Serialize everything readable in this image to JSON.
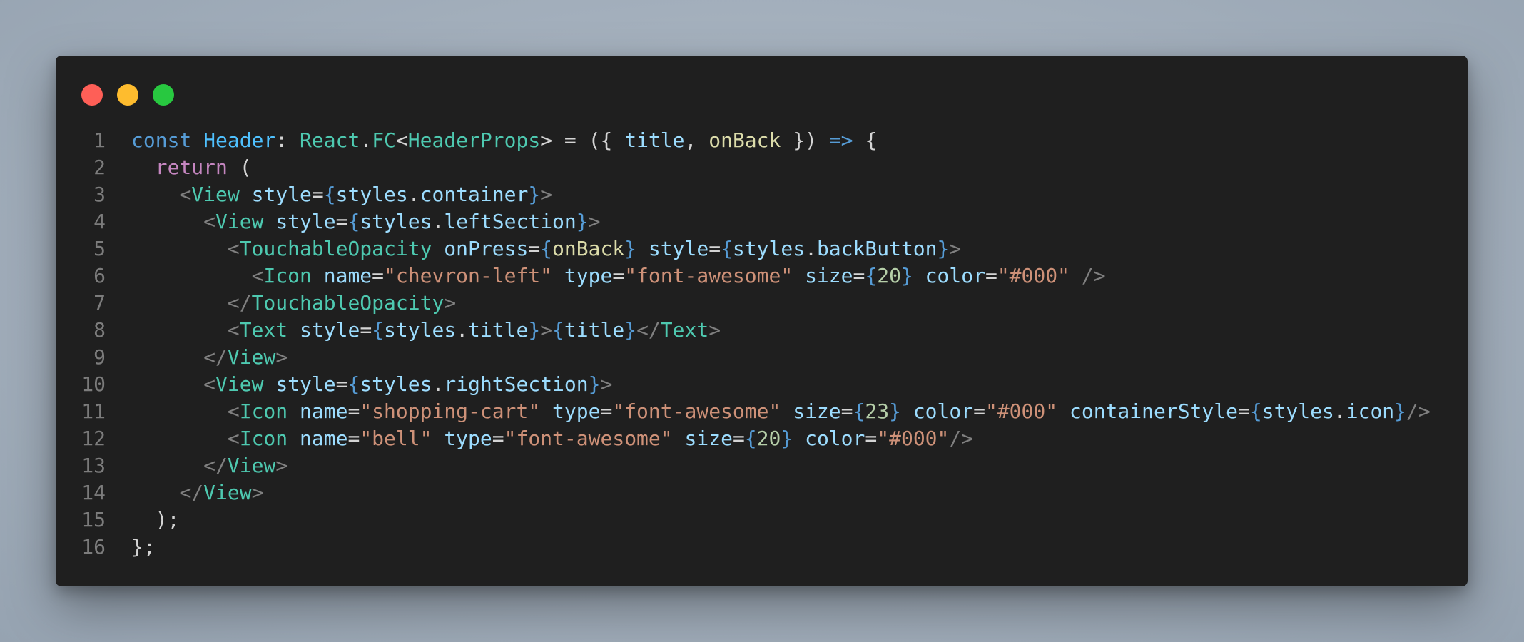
{
  "window": {
    "buttons": [
      {
        "name": "close",
        "color": "#fe5f57"
      },
      {
        "name": "minimize",
        "color": "#febc2e"
      },
      {
        "name": "maximize",
        "color": "#28c840"
      }
    ]
  },
  "code": {
    "lines": [
      {
        "n": "1",
        "tokens": [
          [
            "const",
            "kw"
          ],
          [
            " ",
            "pu"
          ],
          [
            "Header",
            "cn"
          ],
          [
            ": ",
            "pu"
          ],
          [
            "React",
            "ty"
          ],
          [
            ".",
            "pu"
          ],
          [
            "FC",
            "ty"
          ],
          [
            "<",
            "pu"
          ],
          [
            "HeaderProps",
            "ty"
          ],
          [
            "> = ({ ",
            "pu"
          ],
          [
            "title",
            "vr"
          ],
          [
            ", ",
            "pu"
          ],
          [
            "onBack",
            "fn"
          ],
          [
            " }) ",
            "pu"
          ],
          [
            "=>",
            "kw"
          ],
          [
            " {",
            "pu"
          ]
        ]
      },
      {
        "n": "2",
        "tokens": [
          [
            "  ",
            "pu"
          ],
          [
            "return",
            "kw2"
          ],
          [
            " (",
            "pu"
          ]
        ]
      },
      {
        "n": "3",
        "tokens": [
          [
            "    ",
            "pu"
          ],
          [
            "<",
            "tg"
          ],
          [
            "View",
            "ty"
          ],
          [
            " ",
            "pu"
          ],
          [
            "style",
            "at"
          ],
          [
            "=",
            "pu"
          ],
          [
            "{",
            "br"
          ],
          [
            "styles",
            "vr"
          ],
          [
            ".",
            "pu"
          ],
          [
            "container",
            "vr"
          ],
          [
            "}",
            "br"
          ],
          [
            ">",
            "tg"
          ]
        ]
      },
      {
        "n": "4",
        "tokens": [
          [
            "      ",
            "pu"
          ],
          [
            "<",
            "tg"
          ],
          [
            "View",
            "ty"
          ],
          [
            " ",
            "pu"
          ],
          [
            "style",
            "at"
          ],
          [
            "=",
            "pu"
          ],
          [
            "{",
            "br"
          ],
          [
            "styles",
            "vr"
          ],
          [
            ".",
            "pu"
          ],
          [
            "leftSection",
            "vr"
          ],
          [
            "}",
            "br"
          ],
          [
            ">",
            "tg"
          ]
        ]
      },
      {
        "n": "5",
        "tokens": [
          [
            "        ",
            "pu"
          ],
          [
            "<",
            "tg"
          ],
          [
            "TouchableOpacity",
            "ty"
          ],
          [
            " ",
            "pu"
          ],
          [
            "onPress",
            "at"
          ],
          [
            "=",
            "pu"
          ],
          [
            "{",
            "br"
          ],
          [
            "onBack",
            "fn"
          ],
          [
            "}",
            "br"
          ],
          [
            " ",
            "pu"
          ],
          [
            "style",
            "at"
          ],
          [
            "=",
            "pu"
          ],
          [
            "{",
            "br"
          ],
          [
            "styles",
            "vr"
          ],
          [
            ".",
            "pu"
          ],
          [
            "backButton",
            "vr"
          ],
          [
            "}",
            "br"
          ],
          [
            ">",
            "tg"
          ]
        ]
      },
      {
        "n": "6",
        "tokens": [
          [
            "          ",
            "pu"
          ],
          [
            "<",
            "tg"
          ],
          [
            "Icon",
            "ty"
          ],
          [
            " ",
            "pu"
          ],
          [
            "name",
            "at"
          ],
          [
            "=",
            "pu"
          ],
          [
            "\"chevron-left\"",
            "st"
          ],
          [
            " ",
            "pu"
          ],
          [
            "type",
            "at"
          ],
          [
            "=",
            "pu"
          ],
          [
            "\"font-awesome\"",
            "st"
          ],
          [
            " ",
            "pu"
          ],
          [
            "size",
            "at"
          ],
          [
            "=",
            "pu"
          ],
          [
            "{",
            "br"
          ],
          [
            "20",
            "nu"
          ],
          [
            "}",
            "br"
          ],
          [
            " ",
            "pu"
          ],
          [
            "color",
            "at"
          ],
          [
            "=",
            "pu"
          ],
          [
            "\"#000\"",
            "st"
          ],
          [
            " ",
            "pu"
          ],
          [
            "/>",
            "tg"
          ]
        ]
      },
      {
        "n": "7",
        "tokens": [
          [
            "        ",
            "pu"
          ],
          [
            "</",
            "tg"
          ],
          [
            "TouchableOpacity",
            "ty"
          ],
          [
            ">",
            "tg"
          ]
        ]
      },
      {
        "n": "8",
        "tokens": [
          [
            "        ",
            "pu"
          ],
          [
            "<",
            "tg"
          ],
          [
            "Text",
            "ty"
          ],
          [
            " ",
            "pu"
          ],
          [
            "style",
            "at"
          ],
          [
            "=",
            "pu"
          ],
          [
            "{",
            "br"
          ],
          [
            "styles",
            "vr"
          ],
          [
            ".",
            "pu"
          ],
          [
            "title",
            "vr"
          ],
          [
            "}",
            "br"
          ],
          [
            ">",
            "tg"
          ],
          [
            "{",
            "br"
          ],
          [
            "title",
            "vr"
          ],
          [
            "}",
            "br"
          ],
          [
            "</",
            "tg"
          ],
          [
            "Text",
            "ty"
          ],
          [
            ">",
            "tg"
          ]
        ]
      },
      {
        "n": "9",
        "tokens": [
          [
            "      ",
            "pu"
          ],
          [
            "</",
            "tg"
          ],
          [
            "View",
            "ty"
          ],
          [
            ">",
            "tg"
          ]
        ]
      },
      {
        "n": "10",
        "tokens": [
          [
            "      ",
            "pu"
          ],
          [
            "<",
            "tg"
          ],
          [
            "View",
            "ty"
          ],
          [
            " ",
            "pu"
          ],
          [
            "style",
            "at"
          ],
          [
            "=",
            "pu"
          ],
          [
            "{",
            "br"
          ],
          [
            "styles",
            "vr"
          ],
          [
            ".",
            "pu"
          ],
          [
            "rightSection",
            "vr"
          ],
          [
            "}",
            "br"
          ],
          [
            ">",
            "tg"
          ]
        ]
      },
      {
        "n": "11",
        "tokens": [
          [
            "        ",
            "pu"
          ],
          [
            "<",
            "tg"
          ],
          [
            "Icon",
            "ty"
          ],
          [
            " ",
            "pu"
          ],
          [
            "name",
            "at"
          ],
          [
            "=",
            "pu"
          ],
          [
            "\"shopping-cart\"",
            "st"
          ],
          [
            " ",
            "pu"
          ],
          [
            "type",
            "at"
          ],
          [
            "=",
            "pu"
          ],
          [
            "\"font-awesome\"",
            "st"
          ],
          [
            " ",
            "pu"
          ],
          [
            "size",
            "at"
          ],
          [
            "=",
            "pu"
          ],
          [
            "{",
            "br"
          ],
          [
            "23",
            "nu"
          ],
          [
            "}",
            "br"
          ],
          [
            " ",
            "pu"
          ],
          [
            "color",
            "at"
          ],
          [
            "=",
            "pu"
          ],
          [
            "\"#000\"",
            "st"
          ],
          [
            " ",
            "pu"
          ],
          [
            "containerStyle",
            "at"
          ],
          [
            "=",
            "pu"
          ],
          [
            "{",
            "br"
          ],
          [
            "styles",
            "vr"
          ],
          [
            ".",
            "pu"
          ],
          [
            "icon",
            "vr"
          ],
          [
            "}",
            "br"
          ],
          [
            "/>",
            "tg"
          ]
        ]
      },
      {
        "n": "12",
        "tokens": [
          [
            "        ",
            "pu"
          ],
          [
            "<",
            "tg"
          ],
          [
            "Icon",
            "ty"
          ],
          [
            " ",
            "pu"
          ],
          [
            "name",
            "at"
          ],
          [
            "=",
            "pu"
          ],
          [
            "\"bell\"",
            "st"
          ],
          [
            " ",
            "pu"
          ],
          [
            "type",
            "at"
          ],
          [
            "=",
            "pu"
          ],
          [
            "\"font-awesome\"",
            "st"
          ],
          [
            " ",
            "pu"
          ],
          [
            "size",
            "at"
          ],
          [
            "=",
            "pu"
          ],
          [
            "{",
            "br"
          ],
          [
            "20",
            "nu"
          ],
          [
            "}",
            "br"
          ],
          [
            " ",
            "pu"
          ],
          [
            "color",
            "at"
          ],
          [
            "=",
            "pu"
          ],
          [
            "\"#000\"",
            "st"
          ],
          [
            "/>",
            "tg"
          ]
        ]
      },
      {
        "n": "13",
        "tokens": [
          [
            "      ",
            "pu"
          ],
          [
            "</",
            "tg"
          ],
          [
            "View",
            "ty"
          ],
          [
            ">",
            "tg"
          ]
        ]
      },
      {
        "n": "14",
        "tokens": [
          [
            "    ",
            "pu"
          ],
          [
            "</",
            "tg"
          ],
          [
            "View",
            "ty"
          ],
          [
            ">",
            "tg"
          ]
        ]
      },
      {
        "n": "15",
        "tokens": [
          [
            "  );",
            "pu"
          ]
        ]
      },
      {
        "n": "16",
        "tokens": [
          [
            "};",
            "pu"
          ]
        ]
      }
    ]
  }
}
